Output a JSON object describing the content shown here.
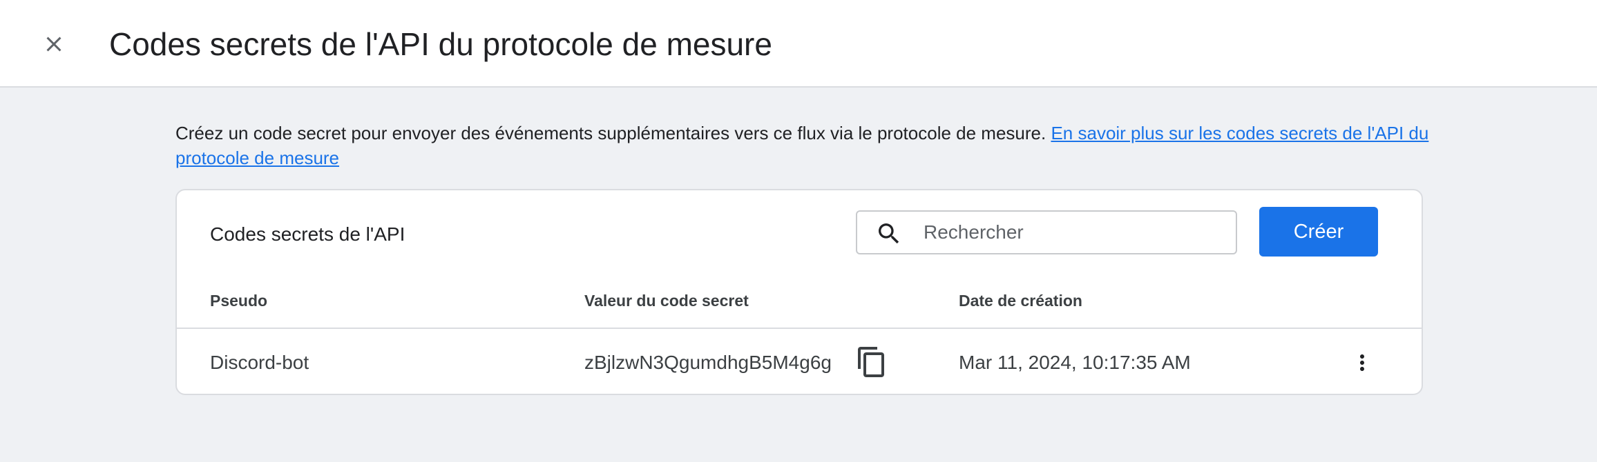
{
  "header": {
    "title": "Codes secrets de l'API du protocole de mesure",
    "close_icon": "close-icon"
  },
  "intro": {
    "text": "Créez un code secret pour envoyer des événements supplémentaires vers ce flux via le protocole de mesure.",
    "link_text": "En savoir plus sur les codes secrets de l'API du protocole de mesure"
  },
  "card": {
    "title": "Codes secrets de l'API",
    "search": {
      "placeholder": "Rechercher",
      "value": "",
      "icon": "search-icon"
    },
    "create_label": "Créer",
    "columns": [
      "Pseudo",
      "Valeur du code secret",
      "Date de création"
    ],
    "rows": [
      {
        "nickname": "Discord-bot",
        "secret_value": "zBjlzwN3QgumdhgB5M4g6g",
        "created": "Mar 11, 2024, 10:17:35 AM",
        "copy_icon": "copy-icon",
        "menu_icon": "more-vert-icon"
      }
    ]
  },
  "colors": {
    "accent": "#1a73e8",
    "background": "#eff1f4",
    "surface": "#ffffff",
    "border": "#dadce0"
  }
}
